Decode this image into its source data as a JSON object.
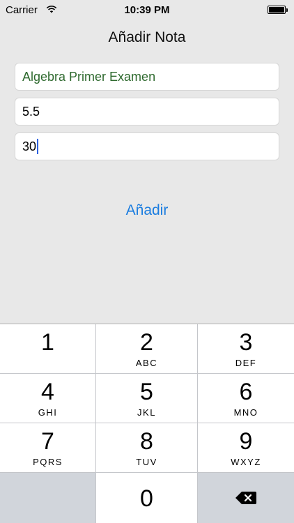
{
  "status_bar": {
    "carrier": "Carrier",
    "time": "10:39 PM"
  },
  "screen": {
    "title": "Añadir Nota"
  },
  "fields": {
    "name": "Algebra Primer Examen",
    "grade": "5.5",
    "percent": "30"
  },
  "add_button": "Añadir",
  "keypad": [
    {
      "digit": "1",
      "letters": ""
    },
    {
      "digit": "2",
      "letters": "ABC"
    },
    {
      "digit": "3",
      "letters": "DEF"
    },
    {
      "digit": "4",
      "letters": "GHI"
    },
    {
      "digit": "5",
      "letters": "JKL"
    },
    {
      "digit": "6",
      "letters": "MNO"
    },
    {
      "digit": "7",
      "letters": "PQRS"
    },
    {
      "digit": "8",
      "letters": "TUV"
    },
    {
      "digit": "9",
      "letters": "WXYZ"
    },
    {
      "digit": "0",
      "letters": ""
    }
  ],
  "colors": {
    "accent": "#1b7de0",
    "first_field_text": "#2f6a2f",
    "background": "#e8e8e8"
  },
  "icons": {
    "wifi": "wifi-icon",
    "battery": "battery-icon",
    "backspace": "backspace-icon"
  }
}
